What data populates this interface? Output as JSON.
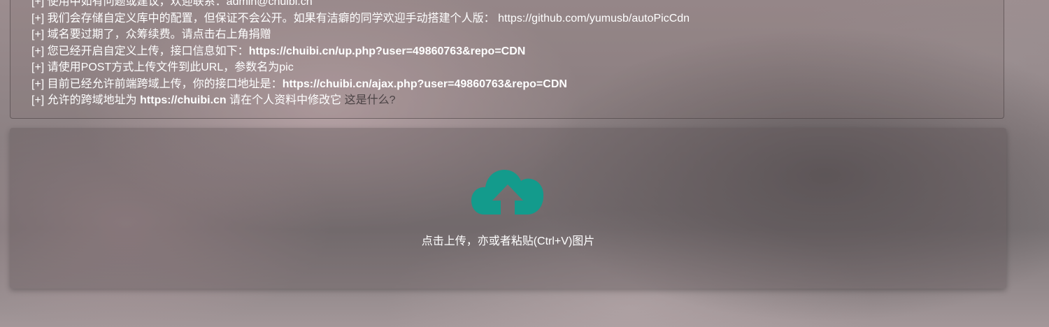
{
  "info": {
    "line0": "[+] 使用中如有问题或建议，欢迎联系：admin@chuibi.cn",
    "line1": {
      "text": "[+] 我们会存储自定义库中的配置，但保证不会公开。如果有洁癖的同学欢迎手动搭建个人版：",
      "link": "https://github.com/yumusb/autoPicCdn"
    },
    "line2": "[+] 域名要过期了，众筹续费。请点击右上角捐赠",
    "line3": {
      "text": "[+] 您已经开启自定义上传，接口信息如下：",
      "url": "https://chuibi.cn/up.php?user=49860763&repo=CDN"
    },
    "line4": "[+] 请使用POST方式上传文件到此URL，参数名为pic",
    "line5": {
      "text": "[+] 目前已经允许前端跨域上传，你的接口地址是：",
      "url": "https://chuibi.cn/ajax.php?user=49860763&repo=CDN"
    },
    "line6": {
      "prefix": "[+] 允许的跨域地址为",
      "domain": "https://chuibi.cn",
      "suffix": "请在个人资料中修改它",
      "help_link": "这是什么?"
    }
  },
  "upload": {
    "icon": "cloud-upload-icon",
    "icon_color": "#139b8c",
    "hint": "点击上传，亦或者粘贴(Ctrl+V)图片"
  }
}
